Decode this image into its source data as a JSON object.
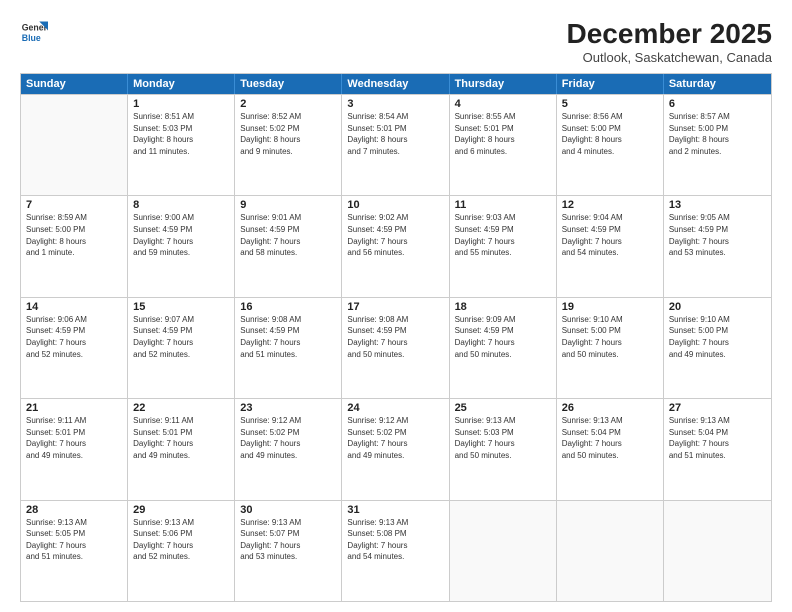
{
  "logo": {
    "line1": "General",
    "line2": "Blue"
  },
  "title": "December 2025",
  "location": "Outlook, Saskatchewan, Canada",
  "headers": [
    "Sunday",
    "Monday",
    "Tuesday",
    "Wednesday",
    "Thursday",
    "Friday",
    "Saturday"
  ],
  "weeks": [
    [
      {
        "day": "",
        "info": ""
      },
      {
        "day": "1",
        "info": "Sunrise: 8:51 AM\nSunset: 5:03 PM\nDaylight: 8 hours\nand 11 minutes."
      },
      {
        "day": "2",
        "info": "Sunrise: 8:52 AM\nSunset: 5:02 PM\nDaylight: 8 hours\nand 9 minutes."
      },
      {
        "day": "3",
        "info": "Sunrise: 8:54 AM\nSunset: 5:01 PM\nDaylight: 8 hours\nand 7 minutes."
      },
      {
        "day": "4",
        "info": "Sunrise: 8:55 AM\nSunset: 5:01 PM\nDaylight: 8 hours\nand 6 minutes."
      },
      {
        "day": "5",
        "info": "Sunrise: 8:56 AM\nSunset: 5:00 PM\nDaylight: 8 hours\nand 4 minutes."
      },
      {
        "day": "6",
        "info": "Sunrise: 8:57 AM\nSunset: 5:00 PM\nDaylight: 8 hours\nand 2 minutes."
      }
    ],
    [
      {
        "day": "7",
        "info": "Sunrise: 8:59 AM\nSunset: 5:00 PM\nDaylight: 8 hours\nand 1 minute."
      },
      {
        "day": "8",
        "info": "Sunrise: 9:00 AM\nSunset: 4:59 PM\nDaylight: 7 hours\nand 59 minutes."
      },
      {
        "day": "9",
        "info": "Sunrise: 9:01 AM\nSunset: 4:59 PM\nDaylight: 7 hours\nand 58 minutes."
      },
      {
        "day": "10",
        "info": "Sunrise: 9:02 AM\nSunset: 4:59 PM\nDaylight: 7 hours\nand 56 minutes."
      },
      {
        "day": "11",
        "info": "Sunrise: 9:03 AM\nSunset: 4:59 PM\nDaylight: 7 hours\nand 55 minutes."
      },
      {
        "day": "12",
        "info": "Sunrise: 9:04 AM\nSunset: 4:59 PM\nDaylight: 7 hours\nand 54 minutes."
      },
      {
        "day": "13",
        "info": "Sunrise: 9:05 AM\nSunset: 4:59 PM\nDaylight: 7 hours\nand 53 minutes."
      }
    ],
    [
      {
        "day": "14",
        "info": "Sunrise: 9:06 AM\nSunset: 4:59 PM\nDaylight: 7 hours\nand 52 minutes."
      },
      {
        "day": "15",
        "info": "Sunrise: 9:07 AM\nSunset: 4:59 PM\nDaylight: 7 hours\nand 52 minutes."
      },
      {
        "day": "16",
        "info": "Sunrise: 9:08 AM\nSunset: 4:59 PM\nDaylight: 7 hours\nand 51 minutes."
      },
      {
        "day": "17",
        "info": "Sunrise: 9:08 AM\nSunset: 4:59 PM\nDaylight: 7 hours\nand 50 minutes."
      },
      {
        "day": "18",
        "info": "Sunrise: 9:09 AM\nSunset: 4:59 PM\nDaylight: 7 hours\nand 50 minutes."
      },
      {
        "day": "19",
        "info": "Sunrise: 9:10 AM\nSunset: 5:00 PM\nDaylight: 7 hours\nand 50 minutes."
      },
      {
        "day": "20",
        "info": "Sunrise: 9:10 AM\nSunset: 5:00 PM\nDaylight: 7 hours\nand 49 minutes."
      }
    ],
    [
      {
        "day": "21",
        "info": "Sunrise: 9:11 AM\nSunset: 5:01 PM\nDaylight: 7 hours\nand 49 minutes."
      },
      {
        "day": "22",
        "info": "Sunrise: 9:11 AM\nSunset: 5:01 PM\nDaylight: 7 hours\nand 49 minutes."
      },
      {
        "day": "23",
        "info": "Sunrise: 9:12 AM\nSunset: 5:02 PM\nDaylight: 7 hours\nand 49 minutes."
      },
      {
        "day": "24",
        "info": "Sunrise: 9:12 AM\nSunset: 5:02 PM\nDaylight: 7 hours\nand 49 minutes."
      },
      {
        "day": "25",
        "info": "Sunrise: 9:13 AM\nSunset: 5:03 PM\nDaylight: 7 hours\nand 50 minutes."
      },
      {
        "day": "26",
        "info": "Sunrise: 9:13 AM\nSunset: 5:04 PM\nDaylight: 7 hours\nand 50 minutes."
      },
      {
        "day": "27",
        "info": "Sunrise: 9:13 AM\nSunset: 5:04 PM\nDaylight: 7 hours\nand 51 minutes."
      }
    ],
    [
      {
        "day": "28",
        "info": "Sunrise: 9:13 AM\nSunset: 5:05 PM\nDaylight: 7 hours\nand 51 minutes."
      },
      {
        "day": "29",
        "info": "Sunrise: 9:13 AM\nSunset: 5:06 PM\nDaylight: 7 hours\nand 52 minutes."
      },
      {
        "day": "30",
        "info": "Sunrise: 9:13 AM\nSunset: 5:07 PM\nDaylight: 7 hours\nand 53 minutes."
      },
      {
        "day": "31",
        "info": "Sunrise: 9:13 AM\nSunset: 5:08 PM\nDaylight: 7 hours\nand 54 minutes."
      },
      {
        "day": "",
        "info": ""
      },
      {
        "day": "",
        "info": ""
      },
      {
        "day": "",
        "info": ""
      }
    ]
  ]
}
